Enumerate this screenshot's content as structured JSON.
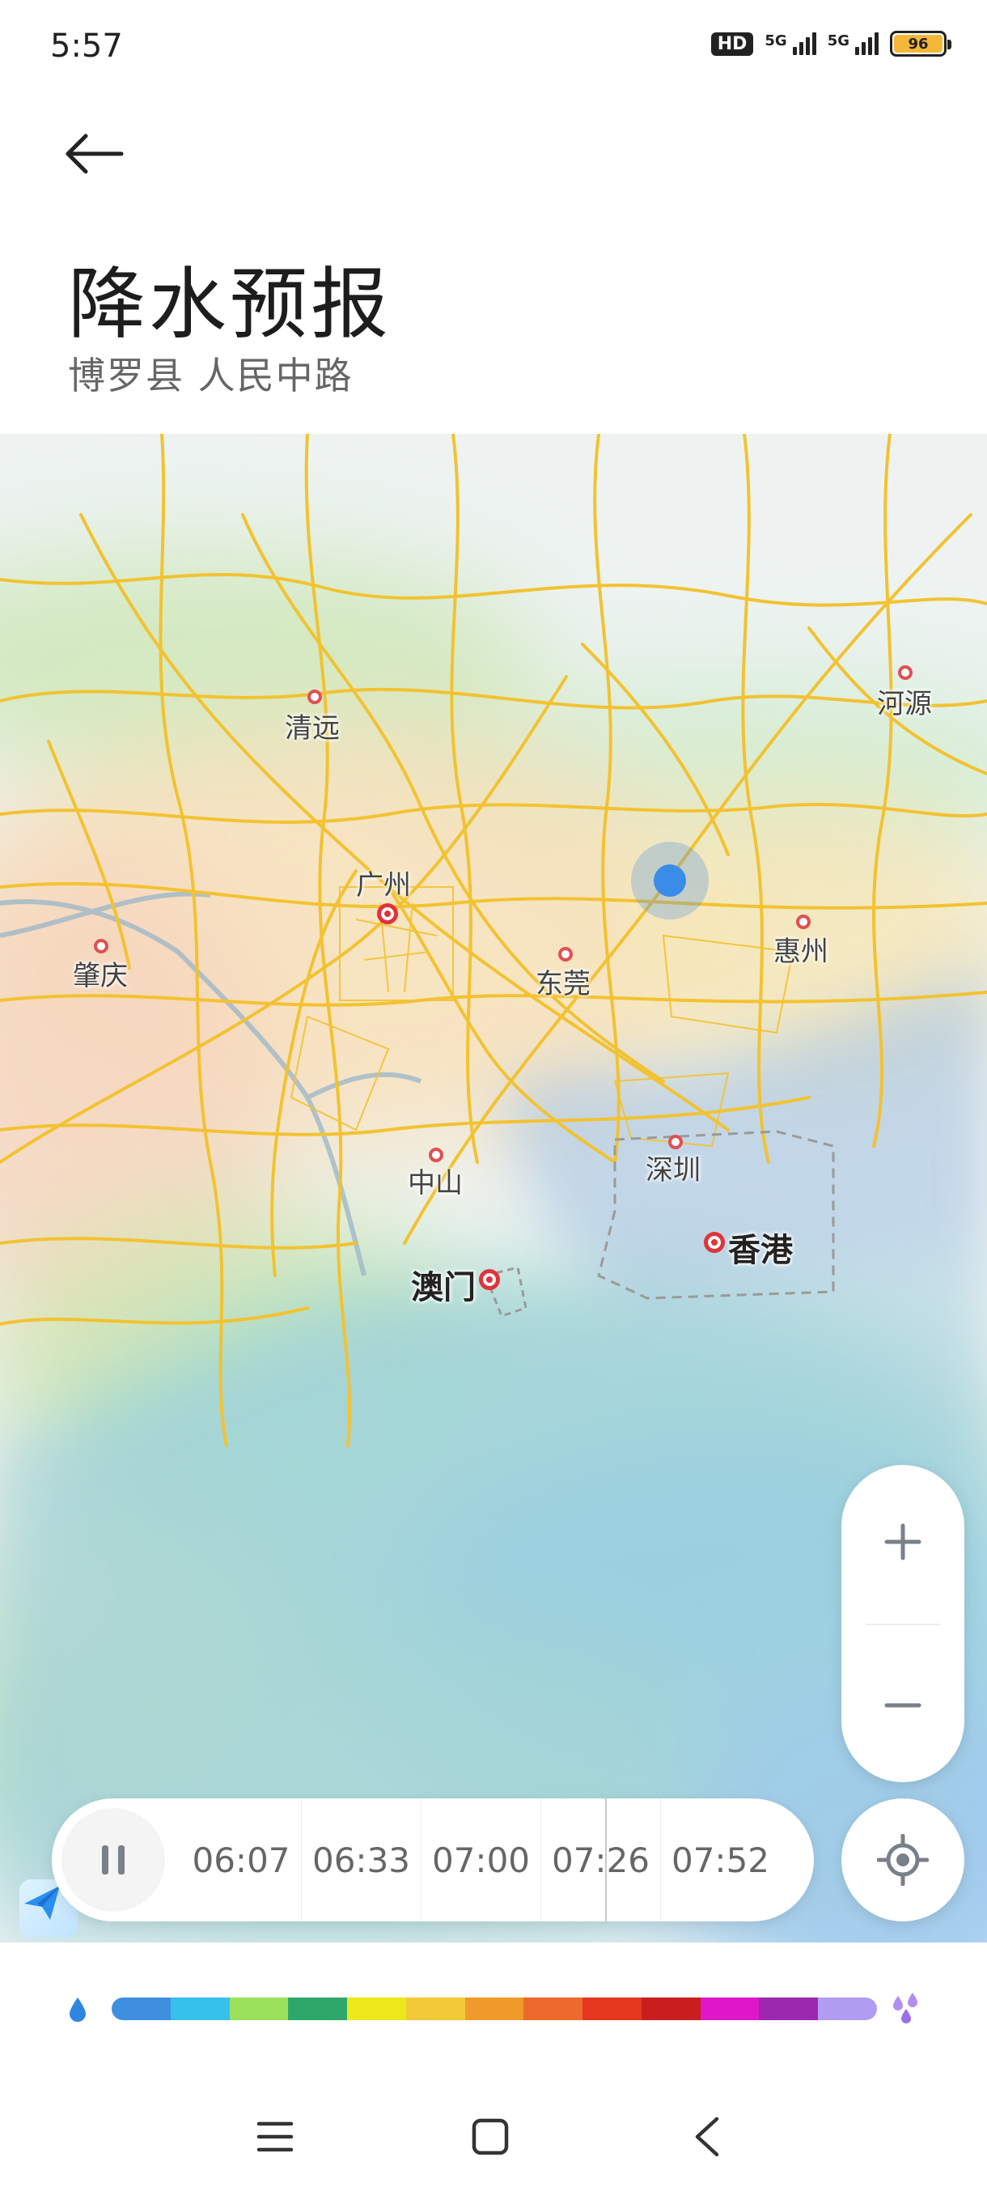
{
  "status_bar": {
    "time": "5:57",
    "hd_label": "HD",
    "network_1": "5G",
    "network_2": "5G",
    "battery": "96"
  },
  "header": {
    "back_icon": "arrow-left-icon",
    "title": "降水预报",
    "subtitle": "博罗县 人民中路"
  },
  "map": {
    "cities": [
      {
        "name": "清远",
        "major": false
      },
      {
        "name": "河源",
        "major": false
      },
      {
        "name": "广州",
        "major": true
      },
      {
        "name": "肇庆",
        "major": false
      },
      {
        "name": "东莞",
        "major": false
      },
      {
        "name": "惠州",
        "major": false
      },
      {
        "name": "中山",
        "major": false
      },
      {
        "name": "深圳",
        "major": false
      },
      {
        "name": "香港",
        "major": true
      },
      {
        "name": "澳门",
        "major": true
      }
    ],
    "road_color": "#f2c231",
    "sea_color": "#a8c9e6"
  },
  "controls": {
    "zoom_in_icon": "plus-icon",
    "zoom_out_icon": "minus-icon",
    "locate_icon": "locate-icon",
    "play_icon": "pause-icon"
  },
  "timeline": {
    "times": [
      "06:07",
      "06:33",
      "07:00",
      "07:26",
      "07:52"
    ]
  },
  "legend": {
    "start_icon": "raindrop-icon",
    "end_icon": "heavy-rain-icon",
    "colors": [
      "#3f8fe0",
      "#36c1ec",
      "#9be15a",
      "#2ea86a",
      "#ece81a",
      "#f3c93a",
      "#ef9a2a",
      "#ec6a2c",
      "#e4371e",
      "#c81e1e",
      "#de18c8",
      "#9c28b0",
      "#b09cf0"
    ]
  },
  "nav": {
    "menu_icon": "menu-icon",
    "home_icon": "home-icon",
    "back_icon": "back-icon"
  }
}
